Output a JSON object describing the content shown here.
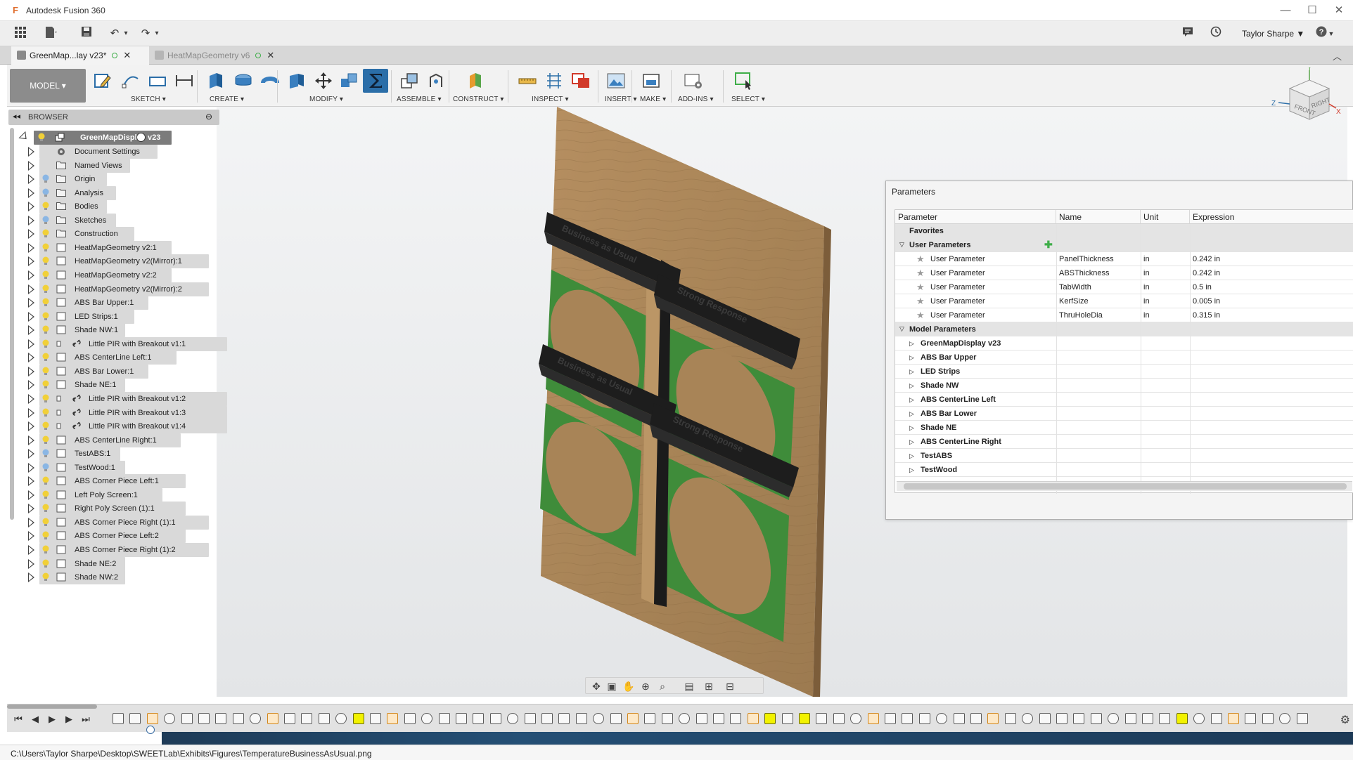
{
  "app": {
    "title": "Autodesk Fusion 360"
  },
  "window": {
    "minimize": "—",
    "maximize": "☐",
    "close": "✕"
  },
  "quick_access": {
    "user": "Taylor Sharpe",
    "user_caret": "▼",
    "help_caret": "▼"
  },
  "tabs": [
    {
      "label": "GreenMap...lay v23*",
      "active": true
    },
    {
      "label": "HeatMapGeometry v6",
      "active": false
    }
  ],
  "ribbon": {
    "workspace": "MODEL ▾",
    "groups": [
      "SKETCH ▾",
      "CREATE ▾",
      "MODIFY ▾",
      "ASSEMBLE ▾",
      "CONSTRUCT ▾",
      "INSPECT ▾",
      "INSERT ▾",
      "MAKE ▾",
      "ADD-INS ▾",
      "SELECT ▾"
    ]
  },
  "browser": {
    "title": "BROWSER",
    "root": "GreenMapDisplay v23",
    "items": [
      {
        "label": "Document Settings",
        "icon": "gear-icon",
        "bulb": false
      },
      {
        "label": "Named Views",
        "icon": "folder-icon",
        "bulb": false
      },
      {
        "label": "Origin",
        "icon": "folder-icon",
        "bulb": "blue"
      },
      {
        "label": "Analysis",
        "icon": "folder-icon",
        "bulb": "blue"
      },
      {
        "label": "Bodies",
        "icon": "folder-icon",
        "bulb": "yellow"
      },
      {
        "label": "Sketches",
        "icon": "folder-icon",
        "bulb": "blue"
      },
      {
        "label": "Construction",
        "icon": "folder-icon",
        "bulb": "yellow"
      },
      {
        "label": "HeatMapGeometry v2:1",
        "icon": "component-icon",
        "bulb": "yellow"
      },
      {
        "label": "HeatMapGeometry v2(Mirror):1",
        "icon": "component-icon",
        "bulb": "yellow"
      },
      {
        "label": "HeatMapGeometry v2:2",
        "icon": "component-icon",
        "bulb": "yellow"
      },
      {
        "label": "HeatMapGeometry v2(Mirror):2",
        "icon": "component-icon",
        "bulb": "yellow"
      },
      {
        "label": "ABS Bar Upper:1",
        "icon": "component-icon",
        "bulb": "yellow"
      },
      {
        "label": "LED Strips:1",
        "icon": "component-icon",
        "bulb": "yellow"
      },
      {
        "label": "Shade NW:1",
        "icon": "component-icon",
        "bulb": "yellow"
      },
      {
        "label": "Little PIR with Breakout v1:1",
        "icon": "link-icon",
        "bulb": "yellow"
      },
      {
        "label": "ABS CenterLine Left:1",
        "icon": "component-icon",
        "bulb": "yellow"
      },
      {
        "label": "ABS Bar Lower:1",
        "icon": "component-icon",
        "bulb": "yellow"
      },
      {
        "label": "Shade NE:1",
        "icon": "component-icon",
        "bulb": "yellow"
      },
      {
        "label": "Little PIR with Breakout v1:2",
        "icon": "link-icon",
        "bulb": "yellow"
      },
      {
        "label": "Little PIR with Breakout v1:3",
        "icon": "link-icon",
        "bulb": "yellow"
      },
      {
        "label": "Little PIR with Breakout v1:4",
        "icon": "link-icon",
        "bulb": "yellow"
      },
      {
        "label": "ABS CenterLine Right:1",
        "icon": "component-icon",
        "bulb": "yellow"
      },
      {
        "label": "TestABS:1",
        "icon": "component-icon",
        "bulb": "blue"
      },
      {
        "label": "TestWood:1",
        "icon": "component-icon",
        "bulb": "blue"
      },
      {
        "label": "ABS Corner Piece Left:1",
        "icon": "component-icon",
        "bulb": "yellow"
      },
      {
        "label": "Left Poly Screen:1",
        "icon": "component-icon",
        "bulb": "yellow"
      },
      {
        "label": "Right Poly Screen (1):1",
        "icon": "component-icon",
        "bulb": "yellow"
      },
      {
        "label": "ABS Corner Piece Right (1):1",
        "icon": "component-icon",
        "bulb": "yellow"
      },
      {
        "label": "ABS Corner Piece Left:2",
        "icon": "component-icon",
        "bulb": "yellow"
      },
      {
        "label": "ABS Corner Piece Right (1):2",
        "icon": "component-icon",
        "bulb": "yellow"
      },
      {
        "label": "Shade NE:2",
        "icon": "component-icon",
        "bulb": "yellow"
      },
      {
        "label": "Shade NW:2",
        "icon": "component-icon",
        "bulb": "yellow"
      }
    ]
  },
  "parameters": {
    "title": "Parameters",
    "columns": [
      "Parameter",
      "Name",
      "Unit",
      "Expression"
    ],
    "favorites_label": "Favorites",
    "user_group_label": "User Parameters",
    "user_params": [
      {
        "type": "User Parameter",
        "name": "PanelThickness",
        "unit": "in",
        "expression": "0.242 in"
      },
      {
        "type": "User Parameter",
        "name": "ABSThickness",
        "unit": "in",
        "expression": "0.242 in"
      },
      {
        "type": "User Parameter",
        "name": "TabWidth",
        "unit": "in",
        "expression": "0.5 in"
      },
      {
        "type": "User Parameter",
        "name": "KerfSize",
        "unit": "in",
        "expression": "0.005 in"
      },
      {
        "type": "User Parameter",
        "name": "ThruHoleDia",
        "unit": "in",
        "expression": "0.315 in"
      }
    ],
    "model_group_label": "Model Parameters",
    "model_params": [
      "GreenMapDisplay v23",
      "ABS Bar Upper",
      "LED Strips",
      "Shade NW",
      "ABS CenterLine Left",
      "ABS Bar Lower",
      "Shade NE",
      "ABS CenterLine Right",
      "TestABS",
      "TestWood"
    ]
  },
  "viewcube": {
    "front": "FRONT",
    "right": "RIGHT",
    "x": "X",
    "y": "Y",
    "z": "Z"
  },
  "model_text": {
    "upper_left": "Business as Usual",
    "upper_right": "Strong Response",
    "lower_left": "Business as Usual",
    "lower_right": "Strong Response"
  },
  "status": {
    "path": "C:\\Users\\Taylor Sharpe\\Desktop\\SWEETLab\\Exhibits\\Figures\\TemperatureBusinessAsUsual.png"
  },
  "colors": {
    "accent": "#2b6ea8",
    "wood": "#b08a5c",
    "abs": "#1c1c1c",
    "screen": "#3f8c3a"
  }
}
